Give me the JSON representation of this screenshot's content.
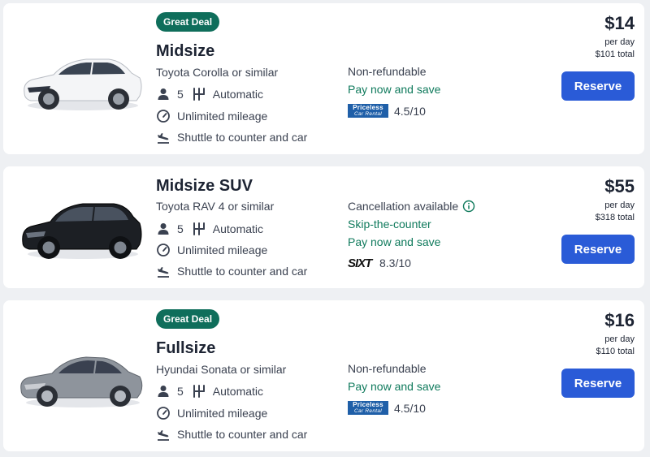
{
  "icons": {
    "person": "person-icon",
    "transmission": "transmission-icon",
    "mileage": "speedometer-icon",
    "shuttle": "plane-landing-icon",
    "info": "info-icon"
  },
  "colors": {
    "badge": "#0f6e5b",
    "green_text": "#0f7a5c",
    "reserve_button": "#2a5bd7"
  },
  "results": [
    {
      "badge": "Great Deal",
      "category": "Midsize",
      "model": "Toyota Corolla or similar",
      "seats": "5",
      "transmission": "Automatic",
      "mileage": "Unlimited mileage",
      "shuttle": "Shuttle to counter and car",
      "policies": [
        "Non-refundable",
        "Pay now and save"
      ],
      "vendor_logo": "Priceless Car Rental",
      "vendor_logo_line1": "Priceless",
      "vendor_logo_line2": "Car Rental",
      "rating": "4.5/10",
      "price": "$14",
      "per_day": "per day",
      "total": "$101 total",
      "reserve_label": "Reserve",
      "car_color": "white"
    },
    {
      "category": "Midsize SUV",
      "model": "Toyota RAV 4 or similar",
      "seats": "5",
      "transmission": "Automatic",
      "mileage": "Unlimited mileage",
      "shuttle": "Shuttle to counter and car",
      "policies": [
        "Cancellation available",
        "Skip-the-counter",
        "Pay now and save"
      ],
      "vendor_logo": "SIXT",
      "rating": "8.3/10",
      "price": "$55",
      "per_day": "per day",
      "total": "$318 total",
      "reserve_label": "Reserve",
      "car_color": "black"
    },
    {
      "badge": "Great Deal",
      "category": "Fullsize",
      "model": "Hyundai Sonata or similar",
      "seats": "5",
      "transmission": "Automatic",
      "mileage": "Unlimited mileage",
      "shuttle": "Shuttle to counter and car",
      "policies": [
        "Non-refundable",
        "Pay now and save"
      ],
      "vendor_logo": "Priceless Car Rental",
      "vendor_logo_line1": "Priceless",
      "vendor_logo_line2": "Car Rental",
      "rating": "4.5/10",
      "price": "$16",
      "per_day": "per day",
      "total": "$110 total",
      "reserve_label": "Reserve",
      "car_color": "silver"
    }
  ]
}
